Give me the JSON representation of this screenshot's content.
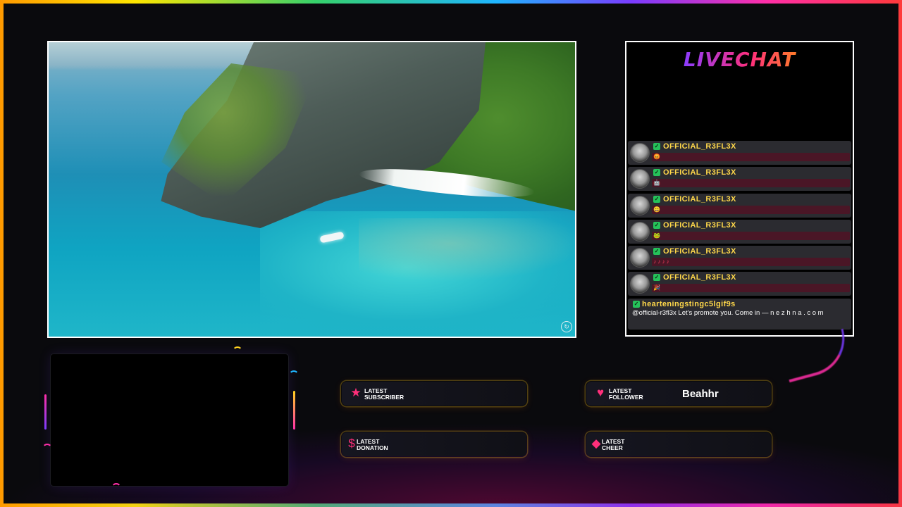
{
  "livechat": {
    "title": "LIVECHAT",
    "messages": [
      {
        "user": "OFFICIAL_R3FL3X",
        "emote": "😡",
        "badge": "✓"
      },
      {
        "user": "OFFICIAL_R3FL3X",
        "emote": "🤖",
        "badge": "✓"
      },
      {
        "user": "OFFICIAL_R3FL3X",
        "emote": "😄",
        "badge": "✓"
      },
      {
        "user": "OFFICIAL_R3FL3X",
        "emote": "🐸",
        "badge": "✓"
      },
      {
        "user": "OFFICIAL_R3FL3X",
        "emote": "♪ ♪ ♪ ♪",
        "badge": "✓"
      },
      {
        "user": "OFFICIAL_R3FL3X",
        "emote": "🎉",
        "badge": "✓"
      },
      {
        "user": "hearteningstingc5lgif9s",
        "text": "@official-r3fl3x Let's promote you. Come in — n e z h n a . c o m",
        "badge": "✓"
      }
    ]
  },
  "widgets": {
    "subscriber": {
      "label1": "LATEST",
      "label2": "SUBSCRIBER",
      "value": "",
      "icon": "star-icon"
    },
    "follower": {
      "label1": "LATEST",
      "label2": "FOLLOWER",
      "value": "Beahhr",
      "icon": "heart-icon"
    },
    "donation": {
      "label1": "LATEST",
      "label2": "DONATION",
      "value": "",
      "icon": "dollar-icon"
    },
    "cheer": {
      "label1": "LATEST",
      "label2": "CHEER",
      "value": "",
      "icon": "diamond-icon"
    }
  },
  "colors": {
    "accent_pink": "#ff2fa8",
    "accent_yellow": "#ffd21f",
    "accent_purple": "#7a3cff",
    "username_yellow": "#ffd84a",
    "message_bar": "#4a1626"
  }
}
